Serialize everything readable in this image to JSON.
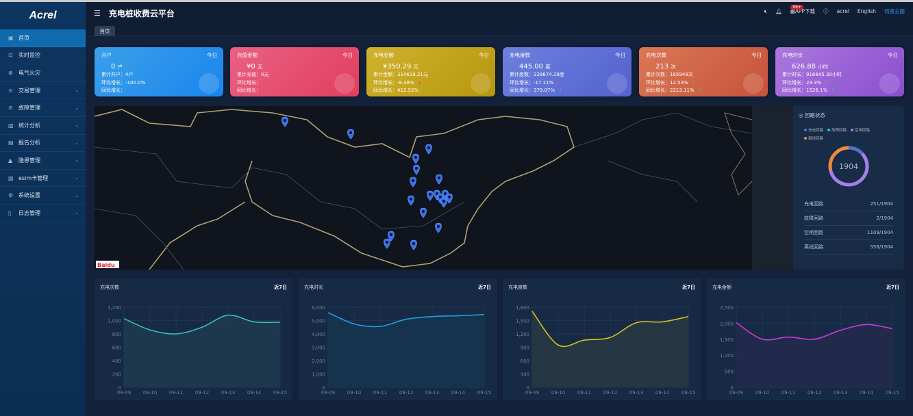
{
  "app": {
    "logo": "Acrel",
    "title": "充电桩收费云平台"
  },
  "header": {
    "notification_count": "99+",
    "app_download": "APP下载",
    "user": "acrel",
    "language": "English",
    "switch_theme": "切换主题"
  },
  "tabs": [
    {
      "label": "首页"
    }
  ],
  "sidebar": {
    "items": [
      {
        "label": "首页",
        "icon": "home-icon",
        "active": true
      },
      {
        "label": "实时监控",
        "icon": "monitor-icon"
      },
      {
        "label": "电气火灾",
        "icon": "fire-icon"
      },
      {
        "label": "交易管理",
        "icon": "transaction-icon",
        "expandable": true
      },
      {
        "label": "故障管理",
        "icon": "fault-icon",
        "expandable": true
      },
      {
        "label": "统计分析",
        "icon": "bar-chart-icon",
        "expandable": true
      },
      {
        "label": "报告分析",
        "icon": "report-icon",
        "expandable": true
      },
      {
        "label": "隐患管理",
        "icon": "warning-icon",
        "expandable": true
      },
      {
        "label": "esim卡管理",
        "icon": "sim-icon",
        "expandable": true
      },
      {
        "label": "系统设置",
        "icon": "settings-icon",
        "expandable": true
      },
      {
        "label": "日志管理",
        "icon": "log-icon",
        "expandable": true
      }
    ]
  },
  "cards": [
    {
      "title": "开户",
      "period": "今日",
      "value": "0",
      "unit": "户",
      "total_label": "累计开户：",
      "total": "4户",
      "mom_label": "环比增长：",
      "mom": "-100.0%",
      "mom_dir": "down",
      "yoy_label": "同比增长：",
      "yoy": "",
      "yoy_dir": "",
      "icon": "users-icon",
      "colors": [
        "#3b9fe9",
        "#1a86ee"
      ]
    },
    {
      "title": "充值金额",
      "period": "今日",
      "value": "¥0",
      "unit": "元",
      "total_label": "累计充值：",
      "total": "0元",
      "mom_label": "环比增长：",
      "mom": "",
      "mom_dir": "",
      "yoy_label": "同比增长：",
      "yoy": "",
      "yoy_dir": "",
      "icon": "money-bag-icon",
      "colors": [
        "#ea6082",
        "#e13f5e"
      ]
    },
    {
      "title": "充电金额",
      "period": "今日",
      "value": "¥350.29",
      "unit": "元",
      "total_label": "累计金额：",
      "total": "314619.21元",
      "mom_label": "环比增长：",
      "mom": "-8.48%",
      "mom_dir": "down",
      "yoy_label": "同比增长：",
      "yoy": "412.52%",
      "yoy_dir": "up",
      "icon": "coin-icon",
      "colors": [
        "#d0b22c",
        "#b8960f"
      ]
    },
    {
      "title": "充电度数",
      "period": "今日",
      "value": "445.00",
      "unit": "度",
      "total_label": "累计度数：",
      "total": "228674.28度",
      "mom_label": "环比增长：",
      "mom": "-17.11%",
      "mom_dir": "down",
      "yoy_label": "同比增长：",
      "yoy": "379.07%",
      "yoy_dir": "up",
      "icon": "charger-icon",
      "colors": [
        "#6c80dd",
        "#5462cf"
      ]
    },
    {
      "title": "充电次数",
      "period": "今日",
      "value": "213",
      "unit": "次",
      "total_label": "累计次数：",
      "total": "165949次",
      "mom_label": "环比增长：",
      "mom": "12.53%",
      "mom_dir": "up",
      "yoy_label": "同比增长：",
      "yoy": "2213.11%",
      "yoy_dir": "up",
      "icon": "database-check-icon",
      "colors": [
        "#da7756",
        "#c7523a"
      ]
    },
    {
      "title": "充电时长",
      "period": "今日",
      "value": "626.88",
      "unit": "小时",
      "total_label": "累计时长：",
      "total": "916645.30小时",
      "mom_label": "环比增长：",
      "mom": "23.3%",
      "mom_dir": "up",
      "yoy_label": "同比增长：",
      "yoy": "1526.1%",
      "yoy_dir": "up",
      "icon": "hourglass-icon",
      "colors": [
        "#aa78dd",
        "#8b4ecf"
      ]
    }
  ],
  "loop_status": {
    "title": "回路状态",
    "total": "1904",
    "items": [
      {
        "label": "充电回路",
        "value": "251/1904",
        "count": 251,
        "color": "#5470c6"
      },
      {
        "label": "故障回路",
        "value": "2/1904",
        "count": 2,
        "color": "#21c6d6"
      },
      {
        "label": "空闲回路",
        "value": "1109/1904",
        "count": 1109,
        "color": "#a77ee8"
      },
      {
        "label": "离线回路",
        "value": "556/1904",
        "count": 556,
        "color": "#f08a3c"
      }
    ]
  },
  "map": {
    "logo": "Baidu"
  },
  "chart_data": [
    {
      "type": "area",
      "title": "充电次数",
      "range": "近7日",
      "categories": [
        "09-09",
        "09-10",
        "09-11",
        "09-12",
        "09-13",
        "09-14",
        "09-15"
      ],
      "values": [
        1030,
        860,
        800,
        900,
        1080,
        980,
        975
      ],
      "ylim": [
        0,
        1200
      ],
      "yticks": [
        "0",
        "200",
        "400",
        "600",
        "800",
        "1,000",
        "1,200"
      ],
      "color": "#3bbcb8",
      "fill": "#1e3a4c",
      "grid": true
    },
    {
      "type": "area",
      "title": "充电时长",
      "range": "近7日",
      "categories": [
        "09-09",
        "09-10",
        "09-11",
        "09-12",
        "09-13",
        "09-14",
        "09-15"
      ],
      "values": [
        5600,
        4750,
        4560,
        5100,
        5300,
        5360,
        5450
      ],
      "ylim": [
        0,
        6000
      ],
      "yticks": [
        "0",
        "1,000",
        "2,000",
        "3,000",
        "4,000",
        "5,000",
        "6,000"
      ],
      "color": "#1fa0e0",
      "fill": "#16344f",
      "grid": true
    },
    {
      "type": "area",
      "title": "充电度数",
      "range": "近7日",
      "categories": [
        "09-09",
        "09-10",
        "09-11",
        "09-12",
        "09-13",
        "09-14",
        "09-15"
      ],
      "values": [
        1710,
        950,
        1060,
        1120,
        1450,
        1470,
        1590
      ],
      "ylim": [
        0,
        1800
      ],
      "yticks": [
        "0",
        "300",
        "600",
        "900",
        "1,200",
        "1,500",
        "1,800"
      ],
      "color": "#d2c21c",
      "fill": "#263841",
      "grid": true
    },
    {
      "type": "area",
      "title": "充电金额",
      "range": "近7日",
      "categories": [
        "09-09",
        "09-10",
        "09-11",
        "09-12",
        "09-13",
        "09-14",
        "09-15"
      ],
      "values": [
        2020,
        1500,
        1570,
        1500,
        1780,
        1960,
        1830
      ],
      "ylim": [
        0,
        2500
      ],
      "yticks": [
        "0",
        "500",
        "1,000",
        "1,500",
        "2,000",
        "2,500"
      ],
      "color": "#c93ad2",
      "fill": "#242a4c",
      "grid": true
    }
  ]
}
